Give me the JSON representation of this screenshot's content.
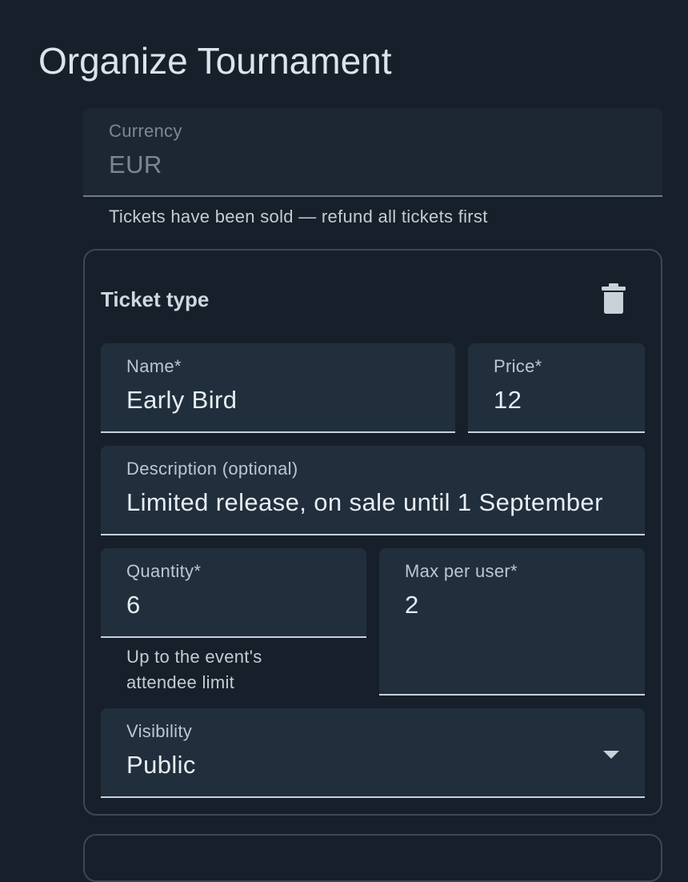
{
  "page": {
    "title": "Organize Tournament"
  },
  "currency": {
    "label": "Currency",
    "value": "EUR",
    "helper": "Tickets have been sold — refund all tickets first"
  },
  "ticket": {
    "title": "Ticket type",
    "delete_icon": "trash-icon",
    "name": {
      "label": "Name*",
      "value": "Early Bird"
    },
    "price": {
      "label": "Price*",
      "value": "12"
    },
    "description": {
      "label": "Description (optional)",
      "value": "Limited release, on sale until 1 September"
    },
    "quantity": {
      "label": "Quantity*",
      "value": "6",
      "helper_line1": "Up to the event's",
      "helper_line2": "attendee limit"
    },
    "max_per_user": {
      "label": "Max per user*",
      "value": "2"
    },
    "visibility": {
      "label": "Visibility",
      "value": "Public",
      "icon": "caret-down-icon"
    }
  },
  "colors": {
    "background": "#17202a",
    "field": "#212f3c",
    "card_border": "#3b4753"
  }
}
